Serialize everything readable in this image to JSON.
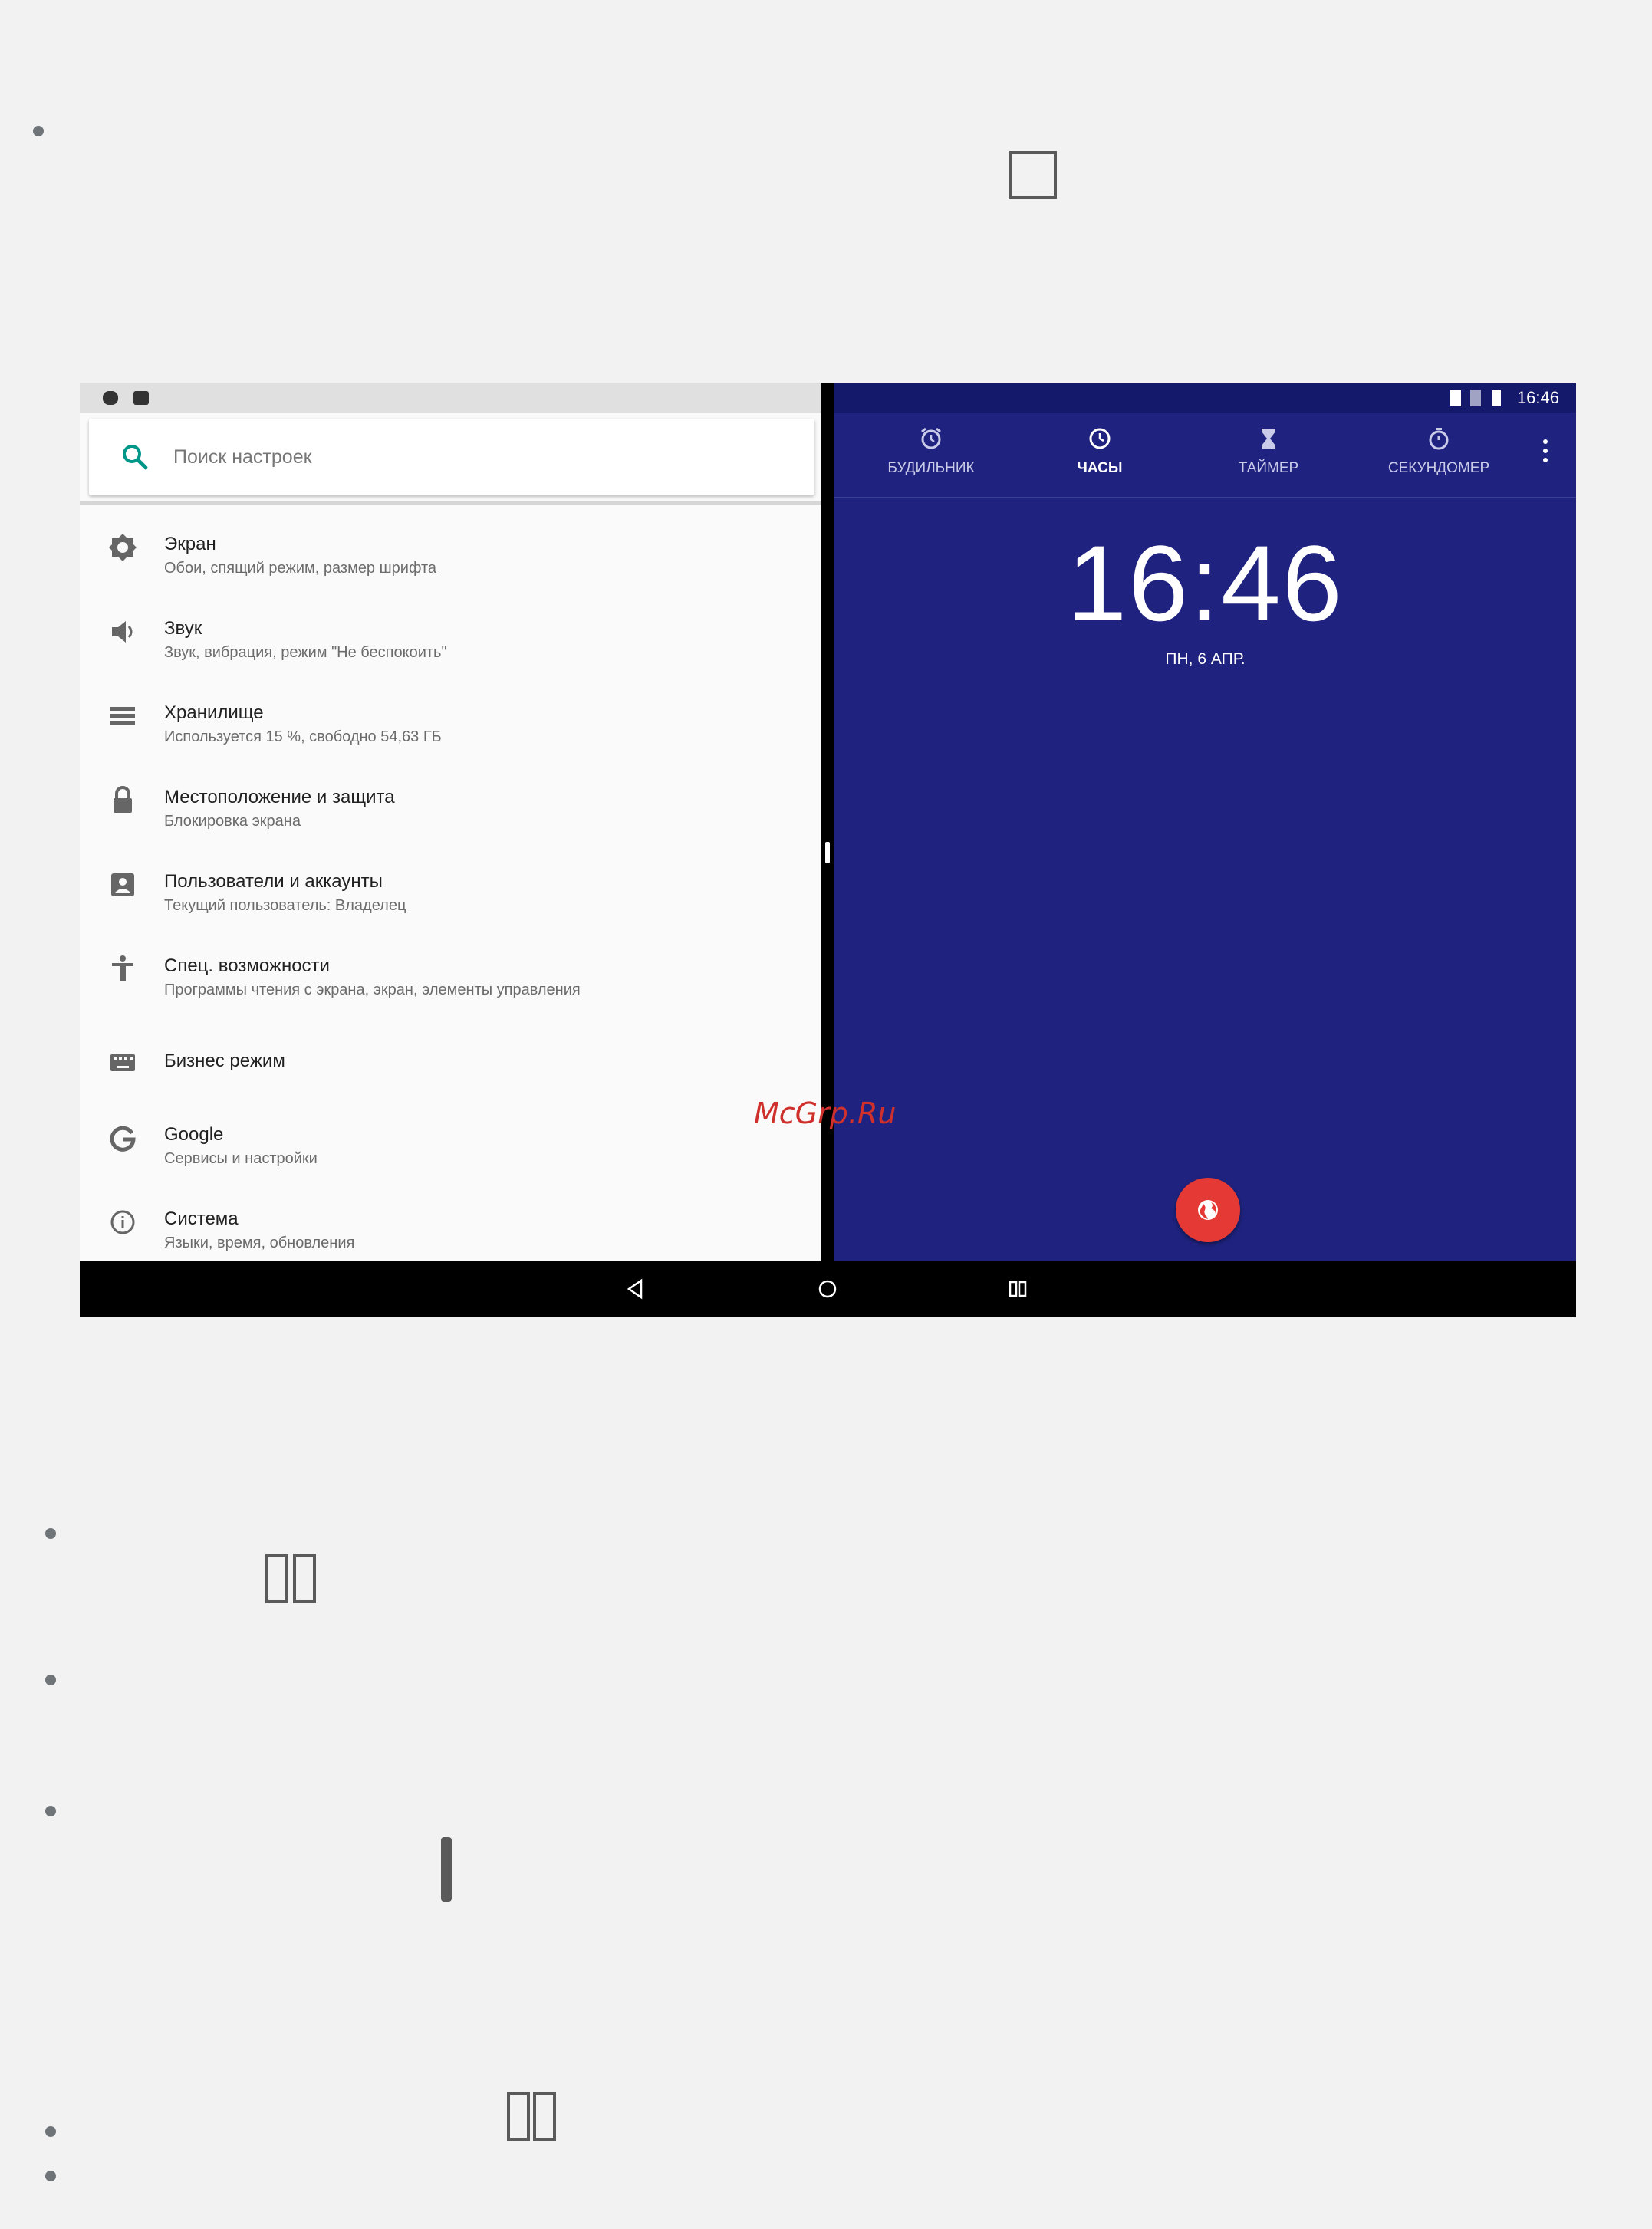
{
  "settings_pane": {
    "search_placeholder": "Поиск настроек",
    "items": [
      {
        "title": "Экран",
        "subtitle": "Обои, спящий режим, размер шрифта",
        "icon": "brightness-icon"
      },
      {
        "title": "Звук",
        "subtitle": "Звук, вибрация, режим \"Не беспокоить\"",
        "icon": "volume-icon"
      },
      {
        "title": "Хранилище",
        "subtitle": "Используется 15 %, свободно 54,63 ГБ",
        "icon": "storage-icon"
      },
      {
        "title": "Местоположение и защита",
        "subtitle": "Блокировка экрана",
        "icon": "lock-icon"
      },
      {
        "title": "Пользователи и аккаунты",
        "subtitle": "Текущий пользователь: Владелец",
        "icon": "account-icon"
      },
      {
        "title": "Спец. возможности",
        "subtitle": "Программы чтения с экрана, экран, элементы управления",
        "icon": "accessibility-icon"
      },
      {
        "title": "Бизнес режим",
        "subtitle": "",
        "icon": "keyboard-icon"
      },
      {
        "title": "Google",
        "subtitle": "Сервисы и настройки",
        "icon": "google-icon"
      },
      {
        "title": "Система",
        "subtitle": "Языки, время, обновления",
        "icon": "info-icon"
      }
    ]
  },
  "clock_pane": {
    "status_time": "16:46",
    "tabs": [
      {
        "label": "БУДИЛЬНИК",
        "icon": "alarm-icon"
      },
      {
        "label": "ЧАСЫ",
        "icon": "clock-icon",
        "active": true
      },
      {
        "label": "ТАЙМЕР",
        "icon": "hourglass-icon"
      },
      {
        "label": "СЕКУНДОМЕР",
        "icon": "stopwatch-icon"
      }
    ],
    "time": "16:46",
    "date": "ПН, 6 АПР.",
    "fab_icon": "globe-icon",
    "background_color": "#1f237f",
    "fab_color": "#e53935"
  },
  "watermark": "McGrp.Ru"
}
